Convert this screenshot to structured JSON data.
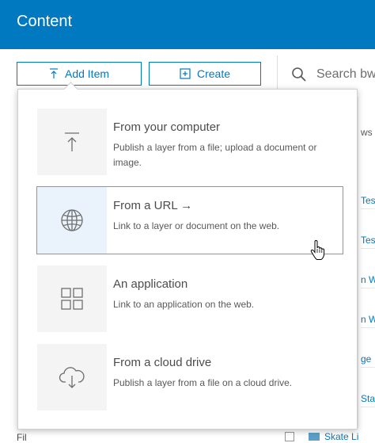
{
  "header": {
    "title": "Content"
  },
  "toolbar": {
    "add_item_label": "Add Item",
    "create_label": "Create",
    "search_placeholder": "Search bw"
  },
  "background": {
    "right_cells": [
      "ws",
      "Test",
      "Test",
      "n W",
      "n W",
      "ge",
      "Stad"
    ],
    "bottom_left": "Fil",
    "bottom_link": "Skate Li"
  },
  "dropdown": {
    "options": [
      {
        "title": "From your computer",
        "description": "Publish a layer from a file; upload a document or image.",
        "icon": "upload-icon"
      },
      {
        "title": "From a URL  →",
        "description": "Link to a layer or document on the web.",
        "icon": "globe-icon"
      },
      {
        "title": "An application",
        "description": "Link to an application on the web.",
        "icon": "apps-grid-icon"
      },
      {
        "title": "From a cloud drive",
        "description": "Publish a layer from a file on a cloud drive.",
        "icon": "cloud-download-icon"
      }
    ]
  },
  "colors": {
    "brand": "#0079c1",
    "text": "#4c4c4c",
    "panel_border": "#cfcfcf",
    "icon_box": "#f4f4f4",
    "hover_box": "#eaf3fb"
  }
}
